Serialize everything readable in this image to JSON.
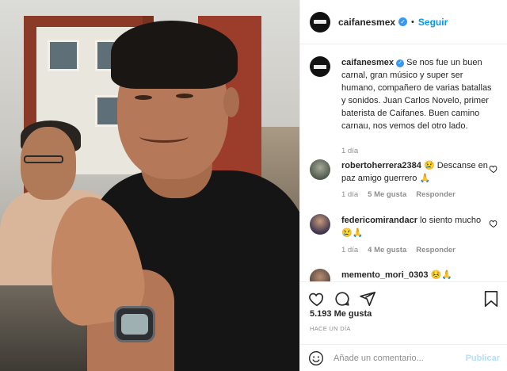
{
  "post": {
    "username": "caifanesmex",
    "follow_label": "Seguir",
    "separator": "•",
    "caption_user": "caifanesmex",
    "caption_text": "Se nos fue un buen carnal, gran músico y super ser humano, compañero de varias batallas y sonidos. Juan Carlos Novelo, primer baterista de Caifanes. Buen camino carnau, nos vemos del otro lado.",
    "caption_time": "1 día"
  },
  "comments": [
    {
      "user": "robertoherrera2384",
      "text": "😢 Descanse en paz amigo guerrero 🙏",
      "time": "1 día",
      "likes": "5 Me gusta",
      "reply": "Responder"
    },
    {
      "user": "federicomirandacr",
      "text": "lo siento mucho 😢🙏",
      "time": "1 día",
      "likes": "4 Me gusta",
      "reply": "Responder"
    },
    {
      "user": "memento_mori_0303",
      "text": "😣🙏"
    }
  ],
  "footer": {
    "likes_count": "5.193 Me gusta",
    "posted_ago": "HACE UN DÍA",
    "comment_placeholder": "Añade un comentario...",
    "publish_label": "Publicar"
  },
  "icons": [
    "heart-icon",
    "comment-icon",
    "share-icon",
    "bookmark-icon",
    "emoji-icon",
    "verified-icon"
  ],
  "colors": {
    "accent": "#0095f6",
    "verified": "#3897f0",
    "muted": "#8e8e8e",
    "border": "#efefef"
  }
}
